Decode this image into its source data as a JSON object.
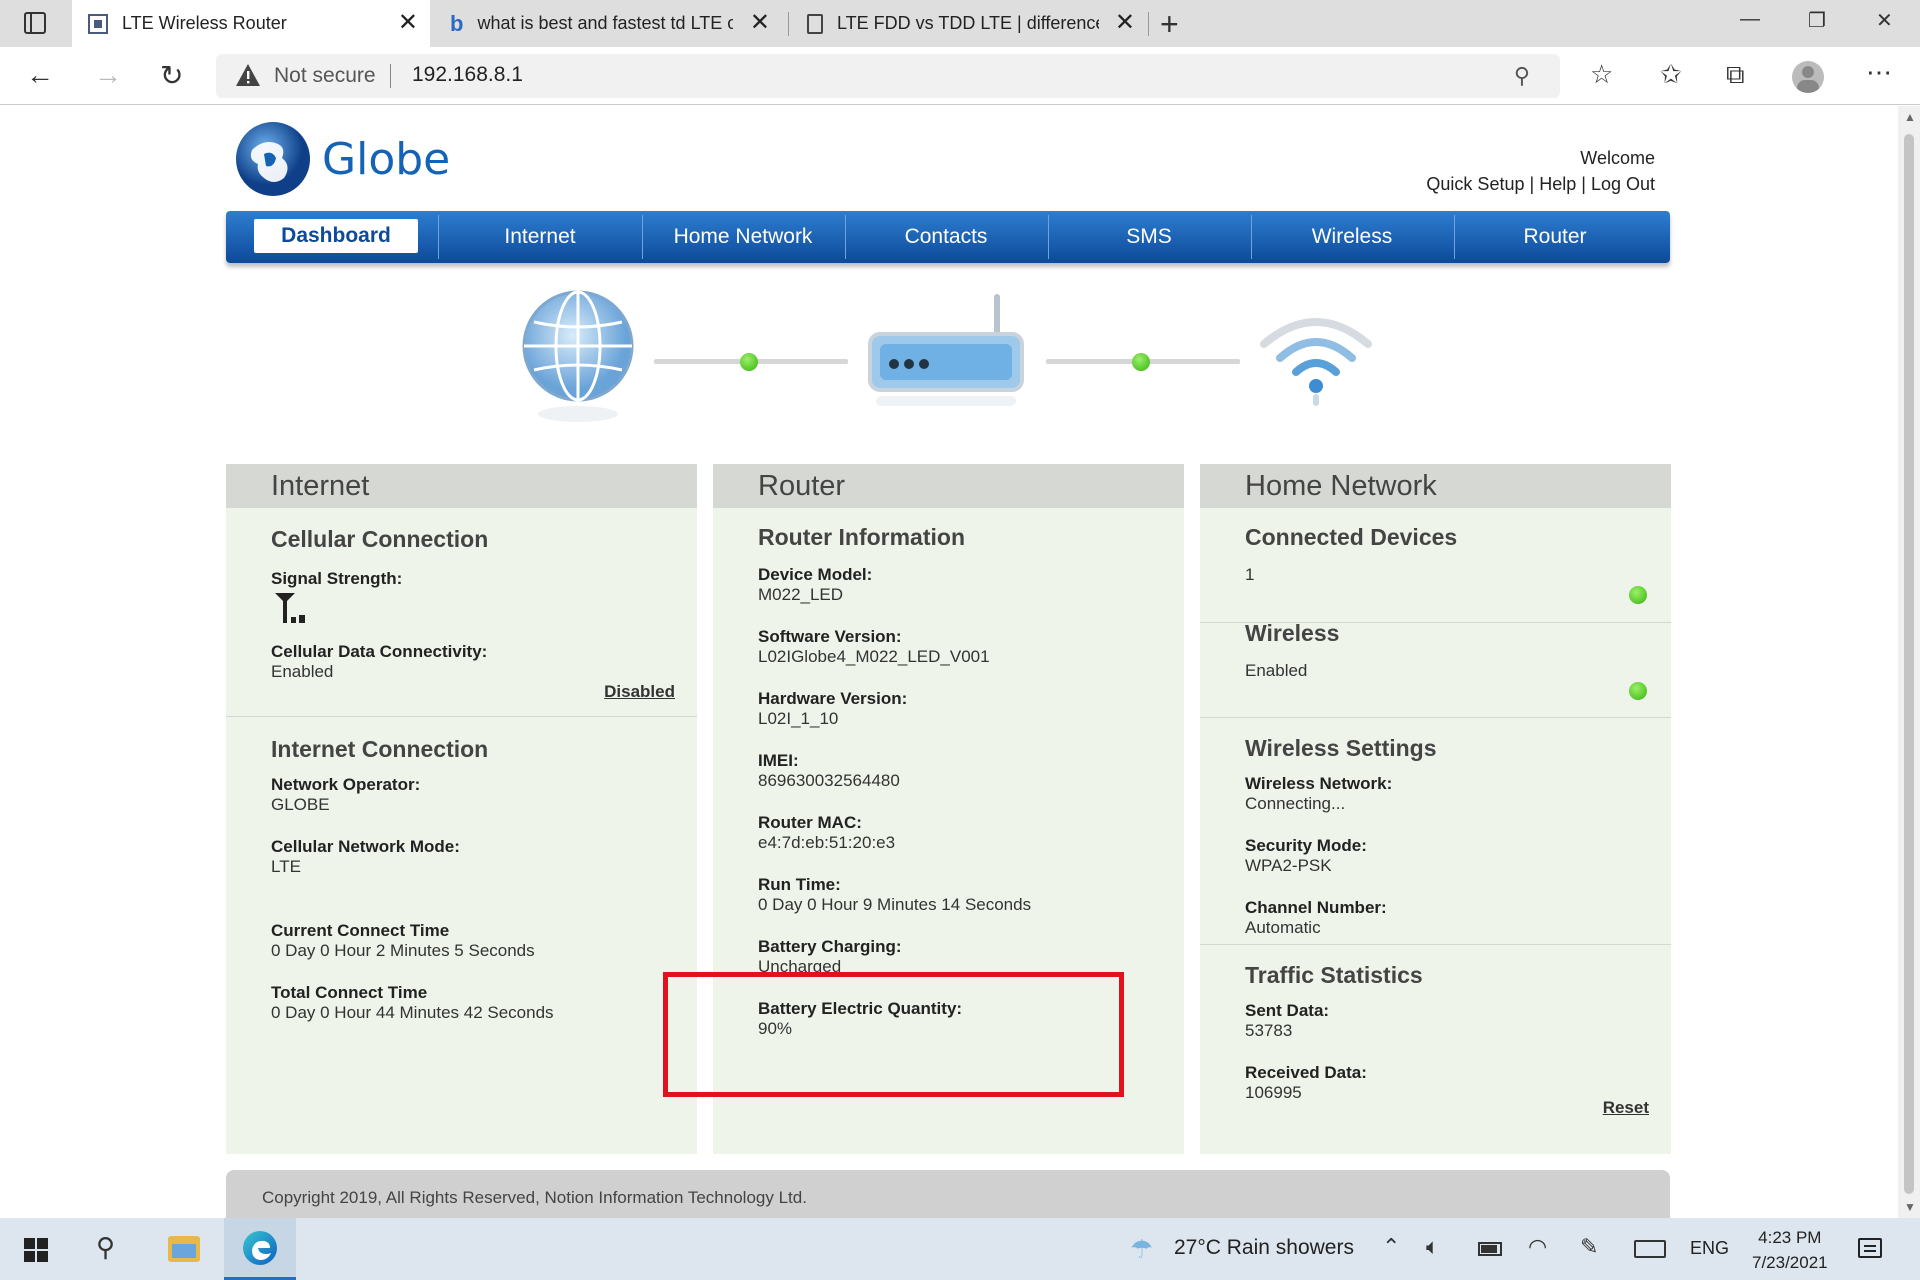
{
  "browser": {
    "tabs": [
      {
        "title": "LTE Wireless Router",
        "active": true
      },
      {
        "title": "what is best and fastest td LTE or"
      },
      {
        "title": "LTE FDD vs TDD LTE | difference b"
      }
    ],
    "address": {
      "security": "Not secure",
      "url": "192.168.8.1"
    }
  },
  "header": {
    "brand": "Globe",
    "welcome": "Welcome",
    "links": {
      "quick_setup": "Quick Setup",
      "help": "Help",
      "log_out": "Log Out",
      "sep": "|"
    }
  },
  "nav": [
    "Dashboard",
    "Internet",
    "Home Network",
    "Contacts",
    "SMS",
    "Wireless",
    "Router"
  ],
  "internet": {
    "heading": "Internet",
    "cellular": {
      "title": "Cellular Connection",
      "signal_label": "Signal Strength:",
      "data_label": "Cellular Data Connectivity:",
      "data_value": "Enabled",
      "toggle_link": "Disabled"
    },
    "connection": {
      "title": "Internet Connection",
      "operator_label": "Network Operator:",
      "operator_value": "GLOBE",
      "mode_label": "Cellular Network Mode:",
      "mode_value": "LTE",
      "current_label": "Current Connect Time",
      "current_value": "0 Day 0 Hour 2 Minutes 5 Seconds",
      "total_label": "Total Connect Time",
      "total_value": "0 Day 0 Hour 44 Minutes 42 Seconds"
    }
  },
  "router": {
    "heading": "Router",
    "title": "Router Information",
    "model_label": "Device Model:",
    "model_value": "M022_LED",
    "software_label": "Software Version:",
    "software_value": "L02IGlobe4_M022_LED_V001",
    "hardware_label": "Hardware Version:",
    "hardware_value": "L02I_1_10",
    "imei_label": "IMEI:",
    "imei_value": "869630032564480",
    "mac_label": "Router MAC:",
    "mac_value": "e4:7d:eb:51:20:e3",
    "runtime_label": "Run Time:",
    "runtime_value": "0 Day 0 Hour 9 Minutes 14 Seconds",
    "charging_label": "Battery Charging:",
    "charging_value": "Uncharged",
    "quantity_label": "Battery Electric Quantity:",
    "quantity_value": "90%"
  },
  "home": {
    "heading": "Home Network",
    "devices_title": "Connected Devices",
    "devices_value": "1",
    "wireless_title": "Wireless",
    "wireless_value": "Enabled",
    "settings_title": "Wireless Settings",
    "network_label": "Wireless Network:",
    "network_value": "Connecting...",
    "security_label": "Security Mode:",
    "security_value": "WPA2-PSK",
    "channel_label": "Channel Number:",
    "channel_value": "Automatic",
    "traffic_title": "Traffic Statistics",
    "sent_label": "Sent Data:",
    "sent_value": "53783",
    "received_label": "Received Data:",
    "received_value": "106995",
    "reset_link": "Reset"
  },
  "footer": {
    "copyright": "Copyright 2019, All Rights Reserved, Notion Information Technology Ltd."
  },
  "taskbar": {
    "weather": "27°C  Rain showers",
    "language": "ENG",
    "time": "4:23 PM",
    "date": "7/23/2021"
  },
  "colors": {
    "brand_blue": "#1563b6",
    "status_green": "#35b20d",
    "highlight_red": "#e0121b"
  }
}
